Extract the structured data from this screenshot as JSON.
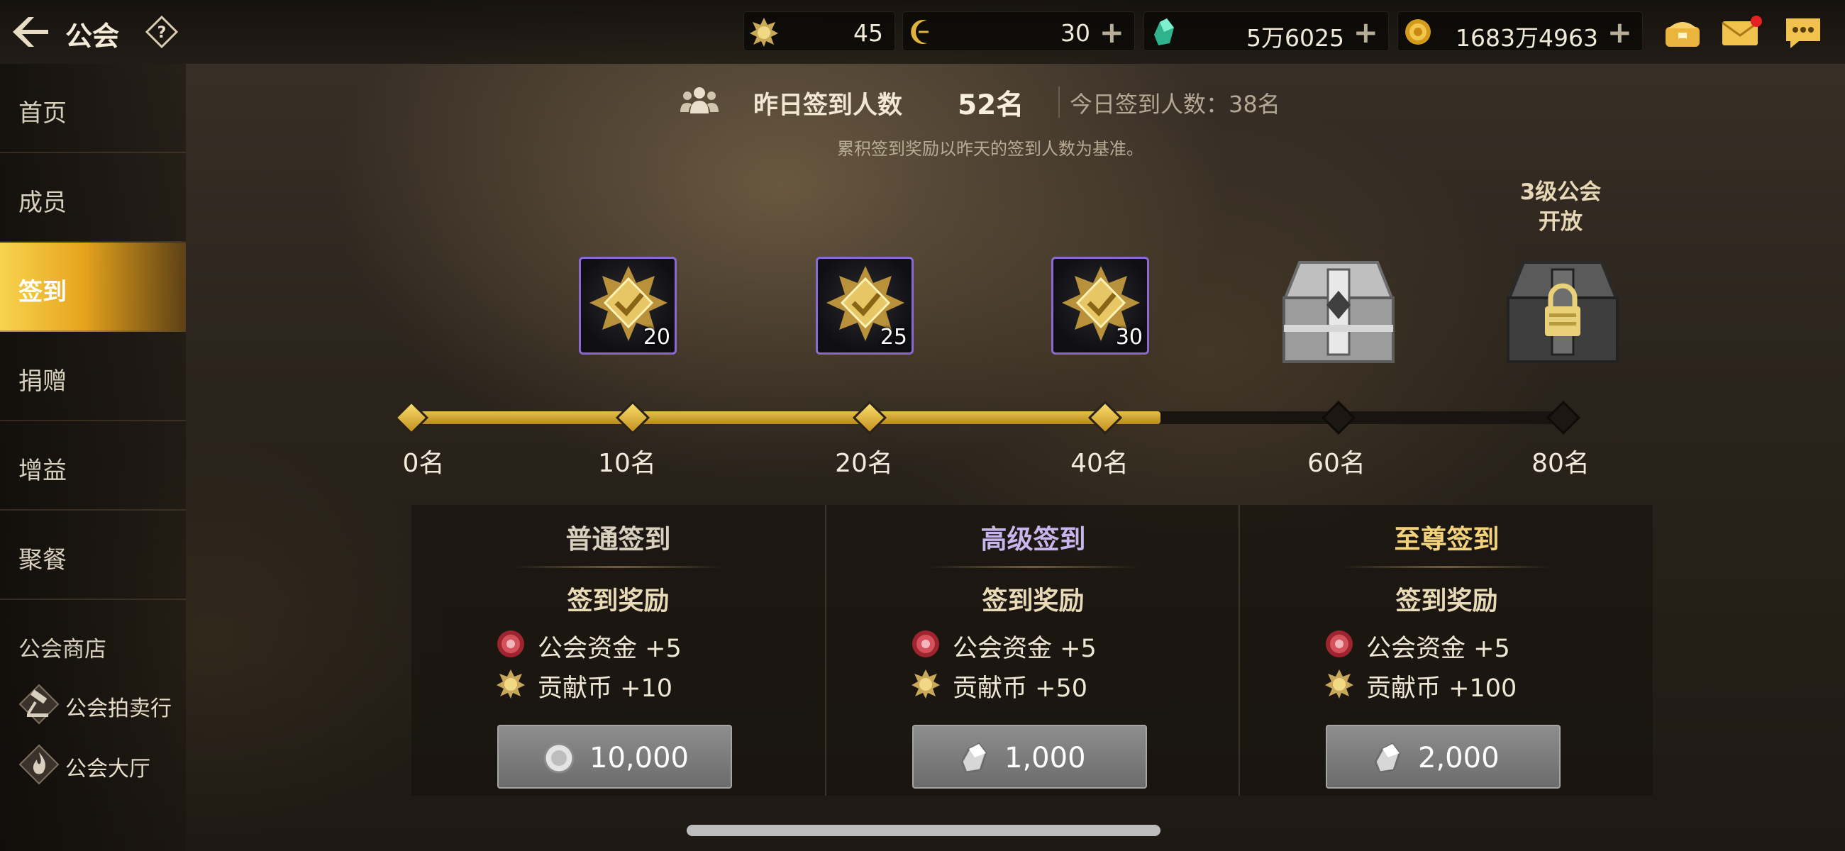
{
  "topbar": {
    "title": "公会",
    "currencies": [
      {
        "icon": "contribution-coin-icon",
        "value": "45"
      },
      {
        "icon": "crescent-coin-icon",
        "value": "30"
      },
      {
        "icon": "green-crystal-icon",
        "value": "5万6025"
      },
      {
        "icon": "gold-coin-icon",
        "value": "1683万4963"
      }
    ],
    "plus_label": "+"
  },
  "sidebar": {
    "items": [
      {
        "label": "首页"
      },
      {
        "label": "成员"
      },
      {
        "label": "签到"
      },
      {
        "label": "捐赠"
      },
      {
        "label": "增益"
      },
      {
        "label": "聚餐"
      }
    ],
    "active_index": 2,
    "shop_label": "公会商店",
    "sub_items": [
      {
        "label": "公会拍卖行",
        "icon": "auction-gavel-icon"
      },
      {
        "label": "公会大厅",
        "icon": "guild-hall-flame-icon"
      }
    ]
  },
  "checkin": {
    "yesterday_label": "昨日签到人数",
    "yesterday_count": "52名",
    "today_text": "今日签到人数：38名",
    "note": "累积签到奖励以昨天的签到人数为基准。"
  },
  "track": {
    "progress_fraction": 0.65,
    "milestones": [
      {
        "label": "0名",
        "reached": true
      },
      {
        "label": "10名",
        "reached": true
      },
      {
        "label": "20名",
        "reached": true
      },
      {
        "label": "40名",
        "reached": true
      },
      {
        "label": "60名",
        "reached": false
      },
      {
        "label": "80名",
        "reached": false
      }
    ],
    "rewards": [
      {
        "amount": "20",
        "icon": "contribution-medal-icon"
      },
      {
        "amount": "25",
        "icon": "contribution-medal-icon"
      },
      {
        "amount": "30",
        "icon": "contribution-medal-icon"
      },
      {
        "icon": "silver-chest-icon"
      },
      {
        "icon": "locked-chest-icon"
      }
    ],
    "lock_label_line1": "3级公会",
    "lock_label_line2": "开放"
  },
  "panels": [
    {
      "title": "普通签到",
      "title_color": "#d9cfbe",
      "subtitle": "签到奖励",
      "rewards": [
        "公会资金 +5",
        "贡献币 +10"
      ],
      "price": "10,000",
      "price_icon": "silver-coin-icon"
    },
    {
      "title": "高级签到",
      "title_color": "#c9b5ee",
      "subtitle": "签到奖励",
      "rewards": [
        "公会资金 +5",
        "贡献币 +50"
      ],
      "price": "1,000",
      "price_icon": "crystal-shard-icon"
    },
    {
      "title": "至尊签到",
      "title_color": "#f3d27a",
      "subtitle": "签到奖励",
      "rewards": [
        "公会资金 +5",
        "贡献币 +100"
      ],
      "price": "2,000",
      "price_icon": "crystal-shard-icon"
    }
  ]
}
